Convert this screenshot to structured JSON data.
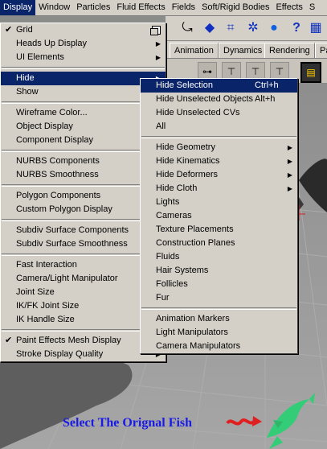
{
  "menubar": [
    "Display",
    "Window",
    "Particles",
    "Fluid Effects",
    "Fields",
    "Soft/Rigid Bodies",
    "Effects",
    "S"
  ],
  "shelf_tabs": [
    "Animation",
    "Dynamics",
    "Rendering",
    "Pa"
  ],
  "display_menu": [
    {
      "label": "Grid",
      "check": true,
      "box": true
    },
    {
      "label": "Heads Up Display",
      "arrow": true
    },
    {
      "label": "UI Elements",
      "arrow": true
    },
    {
      "sep": true
    },
    {
      "label": "Hide",
      "arrow": true,
      "hl": true
    },
    {
      "label": "Show",
      "arrow": true
    },
    {
      "sep": true
    },
    {
      "label": "Wireframe Color..."
    },
    {
      "label": "Object Display",
      "arrow": true
    },
    {
      "label": "Component Display",
      "arrow": true
    },
    {
      "sep": true
    },
    {
      "label": "NURBS Components",
      "arrow": true
    },
    {
      "label": "NURBS Smoothness",
      "arrow": true
    },
    {
      "sep": true
    },
    {
      "label": "Polygon Components",
      "arrow": true
    },
    {
      "label": "Custom Polygon Display"
    },
    {
      "sep": true
    },
    {
      "label": "Subdiv Surface Components",
      "arrow": true
    },
    {
      "label": "Subdiv Surface Smoothness",
      "arrow": true
    },
    {
      "sep": true
    },
    {
      "label": "Fast Interaction"
    },
    {
      "label": "Camera/Light Manipulator",
      "arrow": true
    },
    {
      "label": "Joint Size",
      "arrow": true
    },
    {
      "label": "IK/FK Joint Size",
      "arrow": true
    },
    {
      "label": "IK Handle Size",
      "arrow": true
    },
    {
      "sep": true
    },
    {
      "label": "Paint Effects Mesh Display",
      "check": true
    },
    {
      "label": "Stroke Display Quality",
      "arrow": true
    }
  ],
  "hide_menu": [
    {
      "label": "Hide Selection",
      "shortcut": "Ctrl+h",
      "hl": true
    },
    {
      "label": "Hide Unselected Objects",
      "shortcut": "Alt+h"
    },
    {
      "label": "Hide Unselected CVs"
    },
    {
      "label": "All"
    },
    {
      "sep": true
    },
    {
      "label": "Hide Geometry",
      "arrow": true
    },
    {
      "label": "Hide Kinematics",
      "arrow": true
    },
    {
      "label": "Hide Deformers",
      "arrow": true
    },
    {
      "label": "Hide Cloth",
      "arrow": true
    },
    {
      "label": "Lights"
    },
    {
      "label": "Cameras"
    },
    {
      "label": "Texture Placements"
    },
    {
      "label": "Construction Planes"
    },
    {
      "label": "Fluids"
    },
    {
      "label": "Hair Systems"
    },
    {
      "label": "Follicles"
    },
    {
      "label": "Fur"
    },
    {
      "sep": true
    },
    {
      "label": "Animation Markers"
    },
    {
      "label": "Light Manipulators"
    },
    {
      "label": "Camera Manipulators"
    }
  ],
  "caption": "Select The Orignal Fish",
  "colors": {
    "highlight": "#0a246a",
    "menu_bg": "#d4d0c8",
    "caption": "#1a1ae6",
    "fish": "#33cc77",
    "arrow": "#e02020"
  }
}
